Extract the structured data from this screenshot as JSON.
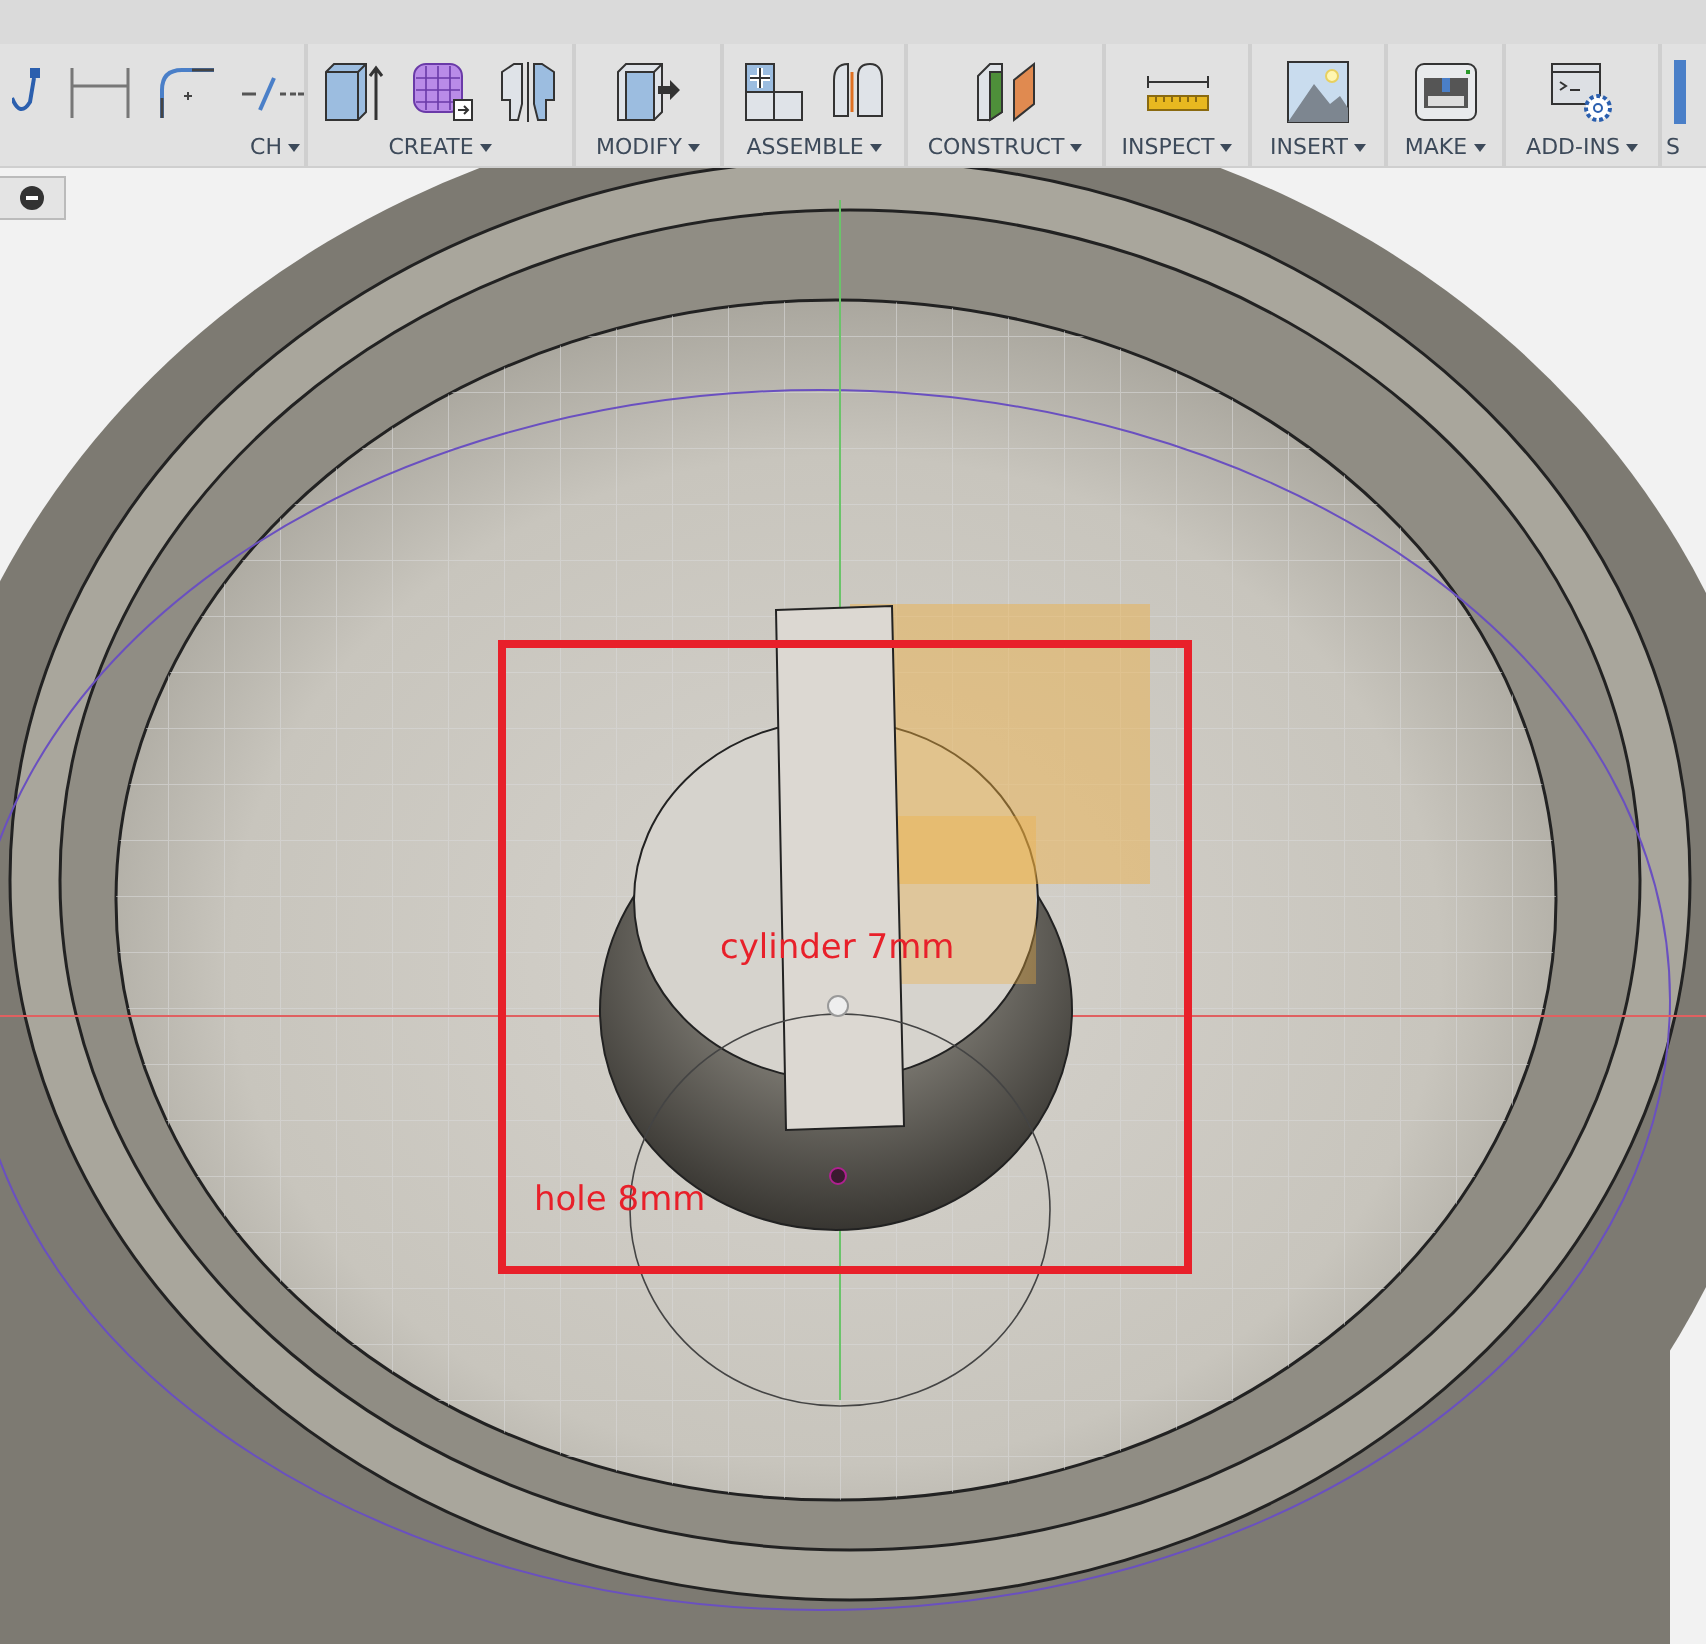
{
  "toolbar": {
    "groups": [
      {
        "label": "CH",
        "has_menu": true
      },
      {
        "label": "CREATE",
        "has_menu": true
      },
      {
        "label": "MODIFY",
        "has_menu": true
      },
      {
        "label": "ASSEMBLE",
        "has_menu": true
      },
      {
        "label": "CONSTRUCT",
        "has_menu": true
      },
      {
        "label": "INSPECT",
        "has_menu": true
      },
      {
        "label": "INSERT",
        "has_menu": true
      },
      {
        "label": "MAKE",
        "has_menu": true
      },
      {
        "label": "ADD-INS",
        "has_menu": true
      },
      {
        "label": "S",
        "has_menu": false
      }
    ]
  },
  "viewport": {
    "annotations": [
      {
        "text": "cylinder 7mm"
      },
      {
        "text": "hole 8mm"
      }
    ]
  }
}
